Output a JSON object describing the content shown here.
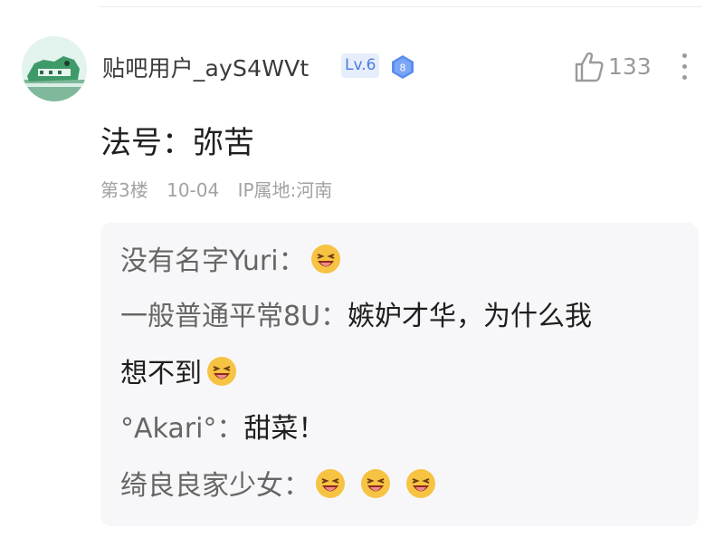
{
  "post": {
    "username": "贴吧用户_ayS4WVt",
    "level_badge": "Lv.6",
    "level_gem_number": "8",
    "like_count": "133",
    "content": "法号：弥苦",
    "meta": {
      "floor": "第3楼",
      "date": "10-04",
      "ip_location": "IP属地:河南"
    }
  },
  "replies": [
    {
      "author": "没有名字Yuri：",
      "text": "",
      "emoji": "grinning-squint-emoji",
      "emoji_count": 1
    },
    {
      "author": "一般普通平常8U：",
      "text": "嫉妒才华，为什么我",
      "emoji": "",
      "emoji_count": 0
    },
    {
      "author": "",
      "text": "想不到",
      "emoji": "grinning-squint-emoji",
      "emoji_count": 1
    },
    {
      "author": "°Akari°：",
      "text": "甜菜！",
      "emoji": "",
      "emoji_count": 0
    },
    {
      "author": "绮良良家少女：",
      "text": "",
      "emoji": "grinning-squint-emoji",
      "emoji_count": 3
    }
  ],
  "colors": {
    "level_badge_bg": "#e6eefc",
    "level_badge_text": "#4a7be0",
    "gem": "#5b8def",
    "emoji_face": "#f6c343",
    "reply_box_bg": "#f7f7f9"
  }
}
